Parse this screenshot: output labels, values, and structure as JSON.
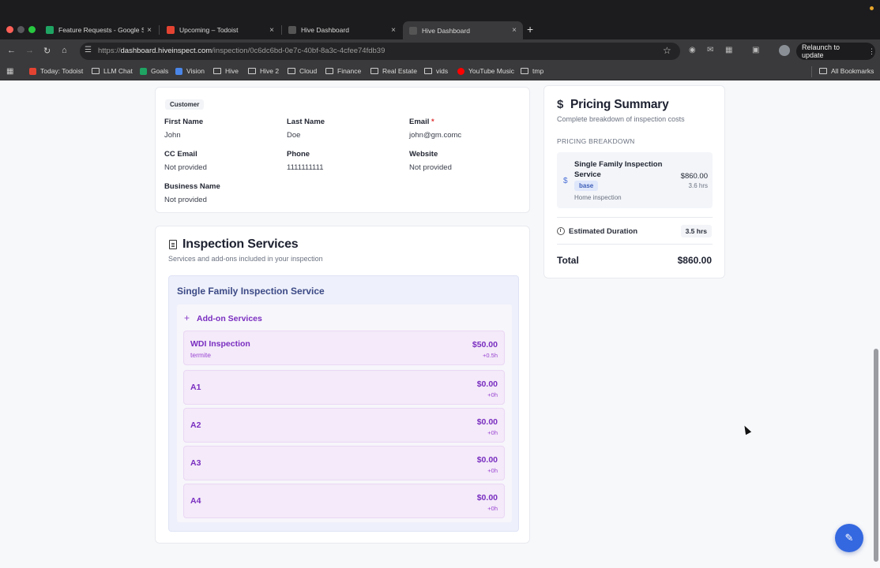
{
  "browser": {
    "tabs": [
      {
        "title": "Feature Requests - Google Sh",
        "color": "#1fa463"
      },
      {
        "title": "Upcoming – Todoist",
        "color": "#e44332"
      },
      {
        "title": "Hive Dashboard",
        "color": "#555555"
      },
      {
        "title": "Hive Dashboard",
        "color": "#555555"
      }
    ],
    "close_glyph": "×",
    "new_tab_glyph": "+",
    "url_prefix": "https://",
    "url_host": "dashboard.hiveinspect.com",
    "url_path": "/inspection/0c6dc6bd-0e7c-40bf-8a3c-4cfee74fdb39",
    "relaunch_label": "Relaunch to update",
    "bookmarks": [
      {
        "label": "Today: Todoist",
        "icon": "todoist-icon",
        "color": "#e44332"
      },
      {
        "label": "LLM Chat",
        "icon": "folder-icon"
      },
      {
        "label": "Goals",
        "icon": "sheets-icon",
        "color": "#1fa463"
      },
      {
        "label": "Vision",
        "icon": "docs-icon",
        "color": "#4a86e8"
      },
      {
        "label": "Hive",
        "icon": "folder-icon"
      },
      {
        "label": "Hive 2",
        "icon": "folder-icon"
      },
      {
        "label": "Cloud",
        "icon": "folder-icon"
      },
      {
        "label": "Finance",
        "icon": "folder-icon"
      },
      {
        "label": "Real Estate",
        "icon": "folder-icon"
      },
      {
        "label": "vids",
        "icon": "folder-icon"
      },
      {
        "label": "YouTube Music",
        "icon": "youtube-music-icon",
        "color": "#ff0000"
      },
      {
        "label": "tmp",
        "icon": "folder-icon"
      }
    ],
    "all_bookmarks": "All Bookmarks"
  },
  "customer": {
    "section_label": "Customer",
    "fields": {
      "first_name": {
        "label": "First Name",
        "value": "John"
      },
      "last_name": {
        "label": "Last Name",
        "value": "Doe"
      },
      "email": {
        "label": "Email",
        "required": "*",
        "value": "john@gm.comc"
      },
      "cc_email": {
        "label": "CC Email",
        "value": "Not provided"
      },
      "phone": {
        "label": "Phone",
        "value": "1111111111"
      },
      "website": {
        "label": "Website",
        "value": "Not provided"
      },
      "business_name": {
        "label": "Business Name",
        "value": "Not provided"
      }
    }
  },
  "services": {
    "title": "Inspection Services",
    "subtitle": "Services and add-ons included in your inspection",
    "main_service": "Single Family Inspection Service",
    "addons_title": "Add-on Services",
    "addons": [
      {
        "name": "WDI Inspection",
        "tag": "termite",
        "price": "$50.00",
        "time": "+0.5h"
      },
      {
        "name": "A1",
        "tag": "",
        "price": "$0.00",
        "time": "+0h"
      },
      {
        "name": "A2",
        "tag": "",
        "price": "$0.00",
        "time": "+0h"
      },
      {
        "name": "A3",
        "tag": "",
        "price": "$0.00",
        "time": "+0h"
      },
      {
        "name": "A4",
        "tag": "",
        "price": "$0.00",
        "time": "+0h"
      }
    ]
  },
  "pricing": {
    "title": "Pricing Summary",
    "subtitle": "Complete breakdown of inspection costs",
    "breakdown_label": "PRICING BREAKDOWN",
    "item": {
      "name": "Single Family Inspection Service",
      "badge": "base",
      "description": "Home inspection",
      "amount": "$860.00",
      "hours": "3.6 hrs"
    },
    "duration_label": "Estimated Duration",
    "duration_value": "3.5 hrs",
    "total_label": "Total",
    "total_value": "$860.00"
  },
  "colors": {
    "accent_blue": "#3468e0",
    "addon_purple": "#7a2ec0",
    "service_navy": "#3c4a86"
  }
}
